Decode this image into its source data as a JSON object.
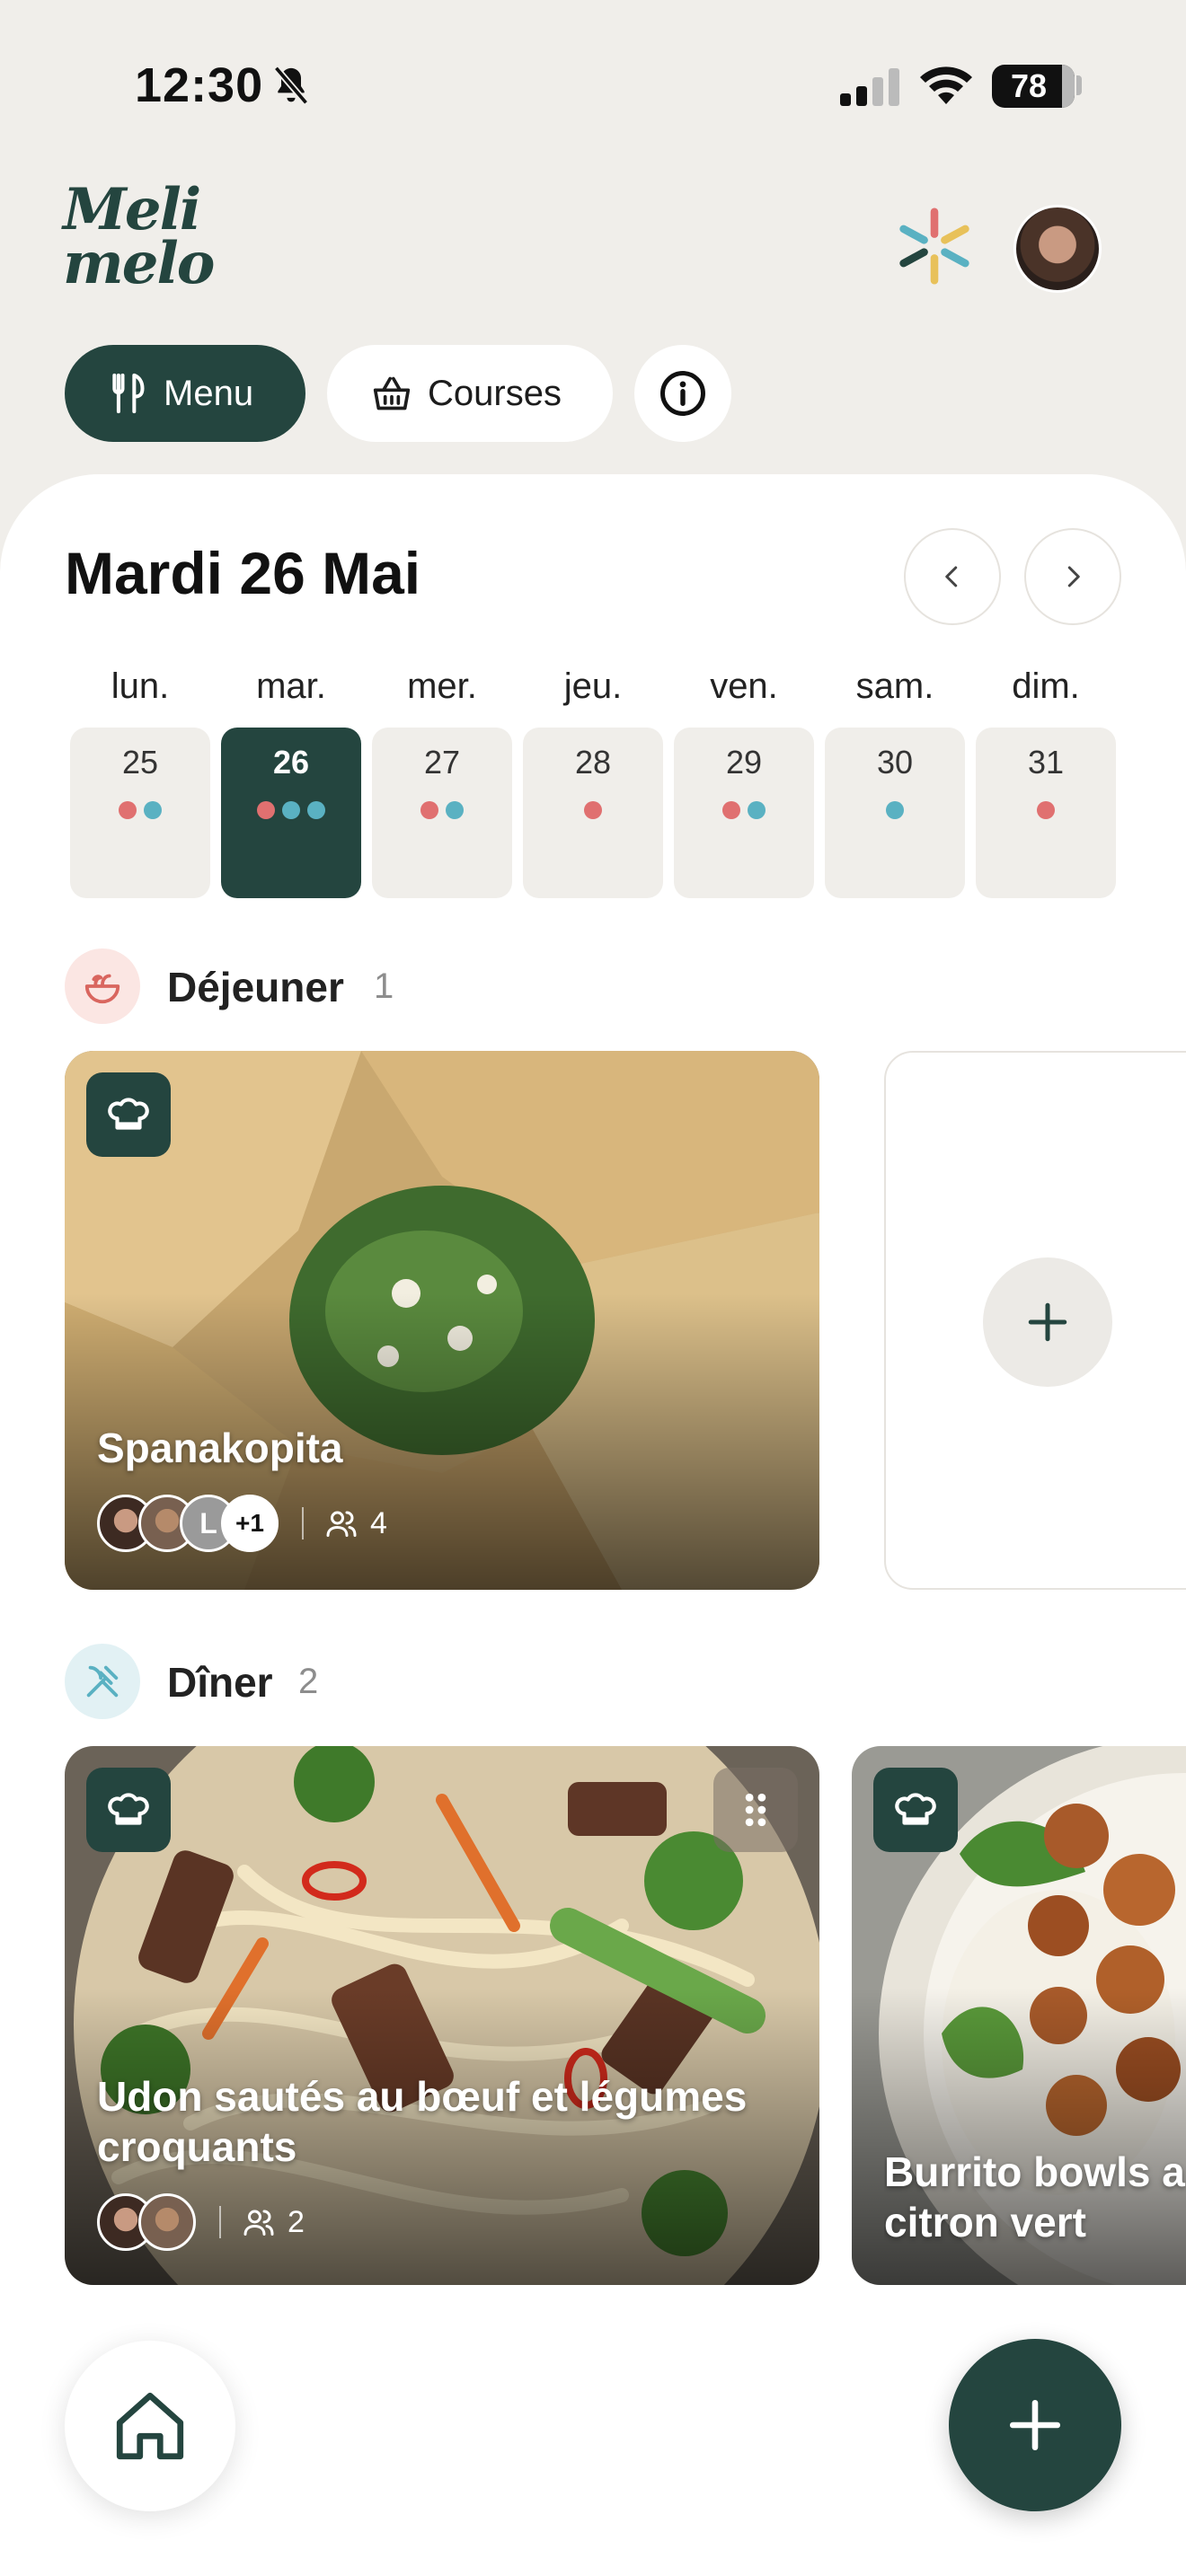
{
  "status_bar": {
    "time": "12:30",
    "battery": "78"
  },
  "header": {
    "logo_line1": "Meli",
    "logo_line2": "melo",
    "tabs": [
      {
        "label": "Menu",
        "icon": "utensils-icon",
        "active": true
      },
      {
        "label": "Courses",
        "icon": "basket-icon",
        "active": false
      }
    ],
    "info_icon": "info-icon"
  },
  "calendar": {
    "title": "Mardi 26 Mai",
    "days": [
      {
        "label": "lun.",
        "num": "25",
        "dots": [
          "r",
          "b"
        ]
      },
      {
        "label": "mar.",
        "num": "26",
        "dots": [
          "r",
          "b",
          "b"
        ],
        "active": true
      },
      {
        "label": "mer.",
        "num": "27",
        "dots": [
          "r",
          "b"
        ]
      },
      {
        "label": "jeu.",
        "num": "28",
        "dots": [
          "r"
        ]
      },
      {
        "label": "ven.",
        "num": "29",
        "dots": [
          "r",
          "b"
        ]
      },
      {
        "label": "sam.",
        "num": "30",
        "dots": [
          "b"
        ]
      },
      {
        "label": "dim.",
        "num": "31",
        "dots": [
          "r"
        ]
      }
    ]
  },
  "lunch": {
    "title": "Déjeuner",
    "count": "1",
    "recipe": {
      "title": "Spanakopita",
      "avatar_initial": "L",
      "more": "+1",
      "people": "4"
    }
  },
  "dinner": {
    "title": "Dîner",
    "count": "2",
    "recipes": [
      {
        "title": "Udon sautés au bœuf et légumes croquants",
        "people": "2"
      },
      {
        "title": "Burrito bowls a citron vert"
      }
    ]
  },
  "colors": {
    "accent": "#24453f",
    "dot_red": "#e07070",
    "dot_blue": "#5ab1c2",
    "background": "#f0eeea"
  }
}
